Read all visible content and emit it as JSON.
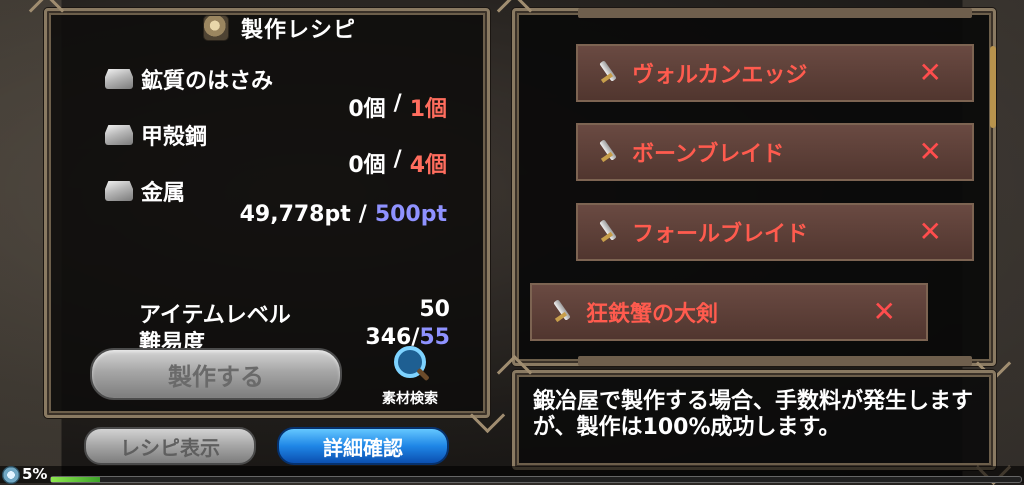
{
  "title": "製作レシピ",
  "materials": [
    {
      "name": "鉱質のはさみ",
      "owned": "0個",
      "required": "1個"
    },
    {
      "name": "甲殻鋼",
      "owned": "0個",
      "required": "4個"
    },
    {
      "name": "金属",
      "owned": "49,778pt",
      "required": "500pt"
    }
  ],
  "separator": "/",
  "stats": {
    "item_level_label": "アイテムレベル",
    "item_level_value": "50",
    "difficulty_label": "難易度",
    "difficulty_current": "346/",
    "difficulty_required": "55"
  },
  "buttons": {
    "craft": "製作する",
    "material_search": "素材検索",
    "recipe_display": "レシピ表示",
    "detail_check": "詳細確認"
  },
  "recipes": [
    {
      "name": "ヴォルカンエッジ"
    },
    {
      "name": "ボーンブレイド"
    },
    {
      "name": "フォールブレイド"
    },
    {
      "name": "狂鉄蟹の大剣"
    }
  ],
  "info_text": "鍛冶屋で製作する場合、手数料が発生しますが、製作は100%成功します。",
  "status": {
    "percent_text": "5%",
    "progress": 0.05
  },
  "colors": {
    "requirement_red": "#ff6d5e",
    "requirement_blue": "#8f92ff",
    "recipe_name": "#ff5b4e",
    "primary_button": "#1f86e6"
  }
}
